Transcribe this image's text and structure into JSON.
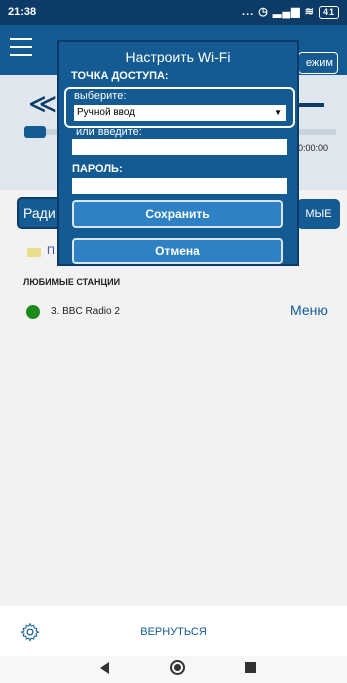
{
  "status_bar": {
    "time": "21:38",
    "icons": "... ◷ ▂▄▆ ≋",
    "battery": "41"
  },
  "app_bar": {
    "mode_button": "ежим"
  },
  "player": {
    "timer": "0:00:00"
  },
  "tabs": {
    "left_label": "Ради",
    "right_label": "МЫЕ"
  },
  "folder": {
    "label": "П"
  },
  "favorites": {
    "section_title": "ЛЮБИМЫЕ СТАНЦИИ",
    "stations": [
      {
        "label": "3. BBC Radio 2",
        "menu": "Меню"
      }
    ]
  },
  "dialog": {
    "title": "Настроить Wi-Fi",
    "access_point_label": "ТОЧКА ДОСТУПА:",
    "choose_label": "выберите:",
    "select_value": "Ручной ввод",
    "or_enter_label": "или введите:",
    "ssid_value": "",
    "password_label": "ПАРОЛЬ:",
    "password_value": "",
    "save_button": "Сохранить",
    "cancel_button": "Отмена"
  },
  "bottom_bar": {
    "back_label": "ВЕРНУТЬСЯ"
  },
  "colors": {
    "primary": "#145b94",
    "dark": "#0b3b66",
    "button": "#2e82c4",
    "station_green": "#1b8a1b"
  }
}
